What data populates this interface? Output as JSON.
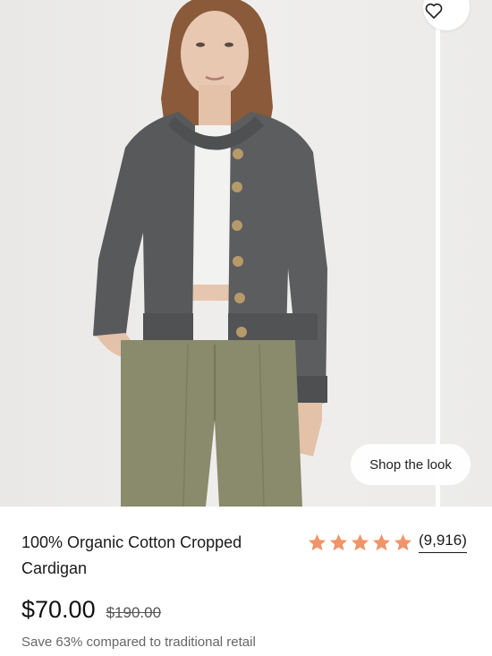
{
  "product": {
    "image_alt": "Woman wearing a charcoal grey cropped cardigan over a white tank top with olive green trousers",
    "title": "100% Organic Cotton Cropped Cardigan",
    "price": "$70.00",
    "original_price": "$190.00",
    "savings_text": "Save 63% compared to traditional retail"
  },
  "rating": {
    "stars": 5,
    "count_label": "(9,916)",
    "star_color": "#f0946a"
  },
  "buttons": {
    "shop_the_look": "Shop the look",
    "favorite_icon": "heart-icon"
  },
  "colors": {
    "cardigan": "#58595a",
    "pants": "#8a8a6a"
  }
}
